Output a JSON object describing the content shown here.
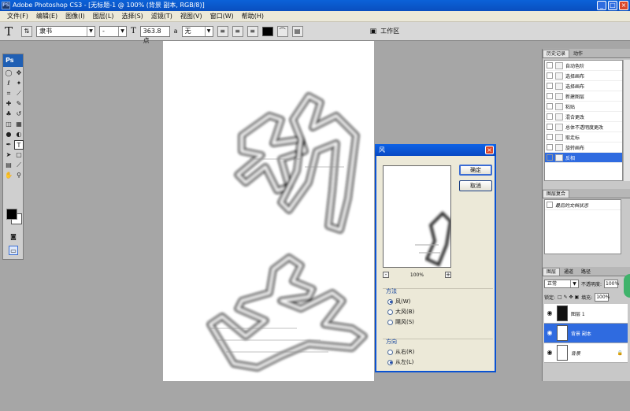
{
  "window": {
    "title": "Adobe Photoshop CS3 - [无标题-1 @ 100% (背景 副本, RGB/8)]",
    "icon": "PS"
  },
  "menu": [
    "文件(F)",
    "编辑(E)",
    "图像(I)",
    "图层(L)",
    "选择(S)",
    "滤镜(T)",
    "视图(V)",
    "窗口(W)",
    "帮助(H)"
  ],
  "options": {
    "font_family": "隶书",
    "font_style": "-",
    "font_size": "363.8 点",
    "antialias": "无",
    "workspace": "工作区"
  },
  "toolbox": {
    "logo": "Ps"
  },
  "dialog": {
    "title": "风",
    "ok": "确定",
    "cancel": "取消",
    "zoom": "100%",
    "method_label": "方法",
    "methods": [
      "风(W)",
      "大风(B)",
      "飓风(S)"
    ],
    "direction_label": "方向",
    "directions": [
      "从右(R)",
      "从左(L)"
    ]
  },
  "history": {
    "tabs": [
      "历史记录",
      "动作"
    ],
    "items": [
      "自动色阶",
      "选择画布",
      "选择画布",
      "新建图层",
      "粘贴",
      "混合更改",
      "总体不透明度更改",
      "取走标",
      "旋转画布",
      "反相"
    ]
  },
  "comps": {
    "tab": "图层复合",
    "text": "最后的文档状态"
  },
  "layers": {
    "tabs": [
      "图层",
      "通道",
      "路径"
    ],
    "blend": "正常",
    "opacity_label": "不透明度:",
    "opacity": "100%",
    "lock_label": "锁定:",
    "fill_label": "填充:",
    "fill": "100%",
    "items": [
      "图层 1",
      "背景 副本",
      "背景"
    ]
  }
}
